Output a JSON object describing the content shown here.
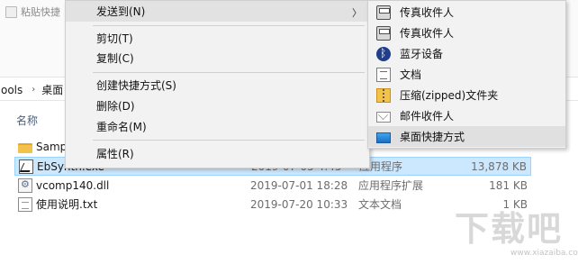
{
  "ribbon": {
    "paste_shortcut_label": "粘贴快捷"
  },
  "address": {
    "segments": [
      "ools",
      "桌面"
    ]
  },
  "columns": {
    "name": "名称"
  },
  "files": [
    {
      "name": "Samp",
      "date": "",
      "type": "",
      "size": "",
      "icon": "folder-icon",
      "selected": false
    },
    {
      "name": "EbSynth.exe",
      "date": "2019-07-05 4:45",
      "type": "应用程序",
      "size": "13,878 KB",
      "icon": "exe-icon",
      "selected": true
    },
    {
      "name": "vcomp140.dll",
      "date": "2019-07-01 18:28",
      "type": "应用程序扩展",
      "size": "181 KB",
      "icon": "dll-icon",
      "selected": false
    },
    {
      "name": "使用说明.txt",
      "date": "2019-07-20 10:33",
      "type": "文本文档",
      "size": "1 KB",
      "icon": "txt-icon",
      "selected": false
    }
  ],
  "context_menu": {
    "send_to": "发送到(N)",
    "cut": "剪切(T)",
    "copy": "复制(C)",
    "create_shortcut": "创建快捷方式(S)",
    "delete": "删除(D)",
    "rename": "重命名(M)",
    "properties": "属性(R)",
    "arrow": "〉"
  },
  "submenu": [
    {
      "label": "传真收件人",
      "icon": "fax-icon"
    },
    {
      "label": "传真收件人",
      "icon": "fax-icon"
    },
    {
      "label": "蓝牙设备",
      "icon": "bluetooth-icon"
    },
    {
      "label": "文档",
      "icon": "document-icon"
    },
    {
      "label": "压缩(zipped)文件夹",
      "icon": "zip-folder-icon"
    },
    {
      "label": "邮件收件人",
      "icon": "mail-icon"
    },
    {
      "label": "桌面快捷方式",
      "icon": "desktop-icon"
    }
  ],
  "watermark": {
    "main": "下载吧",
    "sub": "www.xiazaiba.com"
  },
  "colors": {
    "selection": "#cce8ff",
    "menu_bg": "#f2f2f2",
    "menu_highlight": "#e2e2e2"
  }
}
